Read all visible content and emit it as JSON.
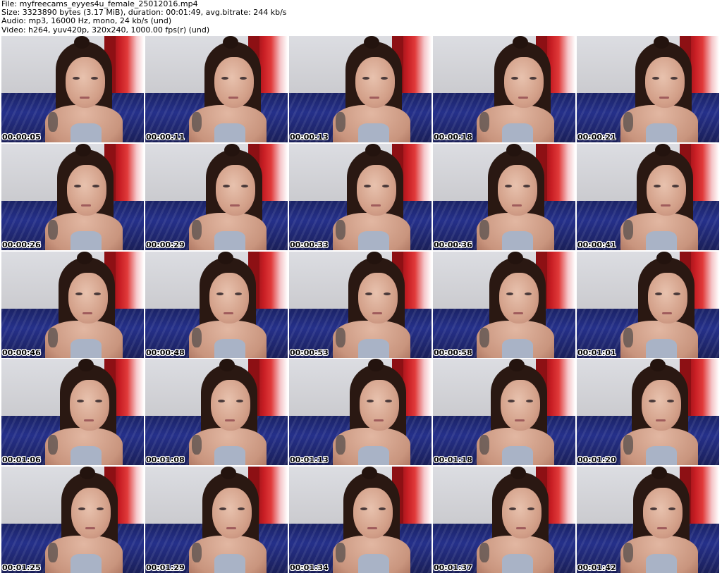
{
  "header": {
    "line1": "File: myfreecams_eyyes4u_female_25012016.mp4",
    "line2": "Size: 3323890 bytes (3.17 MiB), duration: 00:01:49, avg.bitrate: 244 kb/s",
    "line3": "Audio: mp3, 16000 Hz, mono, 24 kb/s (und)",
    "line4": "Video: h264, yuv420p, 320x240, 1000.00 fps(r) (und)"
  },
  "thumbnails": [
    {
      "time": "00:00:05"
    },
    {
      "time": "00:00:11"
    },
    {
      "time": "00:00:13"
    },
    {
      "time": "00:00:18"
    },
    {
      "time": "00:00:21"
    },
    {
      "time": "00:00:26"
    },
    {
      "time": "00:00:29"
    },
    {
      "time": "00:00:33"
    },
    {
      "time": "00:00:36"
    },
    {
      "time": "00:00:41"
    },
    {
      "time": "00:00:46"
    },
    {
      "time": "00:00:48"
    },
    {
      "time": "00:00:53"
    },
    {
      "time": "00:00:58"
    },
    {
      "time": "00:01:01"
    },
    {
      "time": "00:01:06"
    },
    {
      "time": "00:01:08"
    },
    {
      "time": "00:01:13"
    },
    {
      "time": "00:01:18"
    },
    {
      "time": "00:01:20"
    },
    {
      "time": "00:01:25"
    },
    {
      "time": "00:01:29"
    },
    {
      "time": "00:01:34"
    },
    {
      "time": "00:01:37"
    },
    {
      "time": "00:01:42"
    }
  ]
}
